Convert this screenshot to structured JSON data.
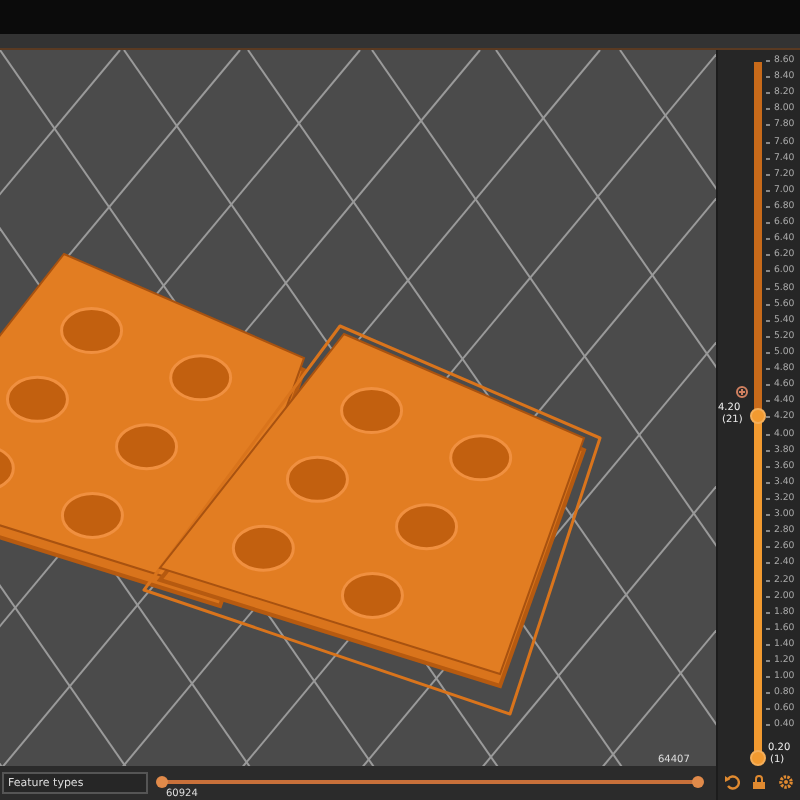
{
  "view_type": {
    "value": "Feature types"
  },
  "horizontal_slider": {
    "lower_thumb": {
      "label": "60924",
      "level": 0
    },
    "upper_thumb": {
      "label": "64407",
      "level": 1
    }
  },
  "vertical_slider": {
    "ticks": [
      "8.60",
      "8.40",
      "8.20",
      "8.00",
      "7.80",
      "7.60",
      "7.40",
      "7.20",
      "7.00",
      "6.80",
      "6.60",
      "6.40",
      "6.20",
      "6.00",
      "5.80",
      "5.60",
      "5.40",
      "5.20",
      "5.00",
      "4.80",
      "4.60",
      "4.40",
      "4.20",
      "4.00",
      "3.80",
      "3.60",
      "3.40",
      "3.20",
      "3.00",
      "2.80",
      "2.60",
      "2.40",
      "2.20",
      "2.00",
      "1.80",
      "1.60",
      "1.40",
      "1.20",
      "1.00",
      "0.80",
      "0.60",
      "0.40"
    ],
    "upper_thumb": {
      "label": "4.20",
      "index": "(21)",
      "level": 0.49
    },
    "lower_thumb": {
      "label": "0.20",
      "index": "(1)",
      "level": 0
    }
  }
}
